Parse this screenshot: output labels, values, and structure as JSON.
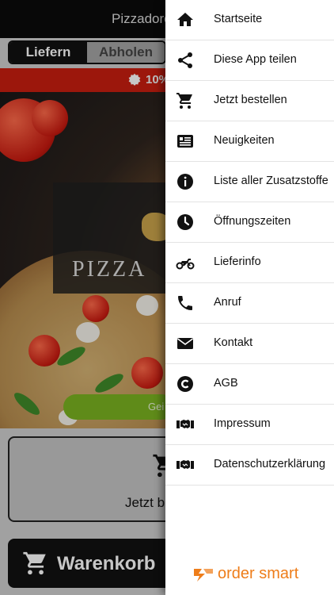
{
  "header": {
    "title": "Pizzadorc"
  },
  "segment": {
    "active_label": "Liefern",
    "inactive_label": "Abholen"
  },
  "promo": {
    "text": "10%",
    "color": "#c81e10"
  },
  "hero": {
    "logo_text": "PIZZA",
    "button_label": "Gei"
  },
  "order_card": {
    "label": "Jetzt b",
    "icon": "cart-add-icon"
  },
  "cart_button": {
    "label": "Warenkorb",
    "icon": "cart-icon"
  },
  "drawer": {
    "items": [
      {
        "label": "Startseite",
        "icon": "home-icon"
      },
      {
        "label": "Diese App teilen",
        "icon": "share-icon"
      },
      {
        "label": "Jetzt bestellen",
        "icon": "cart-icon"
      },
      {
        "label": "Neuigkeiten",
        "icon": "news-icon"
      },
      {
        "label": "Liste aller Zusatzstoffe",
        "icon": "info-icon"
      },
      {
        "label": "Öffnungszeiten",
        "icon": "clock-icon"
      },
      {
        "label": "Lieferinfo",
        "icon": "motorcycle-icon"
      },
      {
        "label": "Anruf",
        "icon": "phone-icon"
      },
      {
        "label": "Kontakt",
        "icon": "mail-icon"
      },
      {
        "label": "AGB",
        "icon": "copyright-icon"
      },
      {
        "label": "Impressum",
        "icon": "handshake-icon"
      },
      {
        "label": "Datenschutzerklärung",
        "icon": "handshake-icon"
      }
    ],
    "brand": {
      "name": "order smart",
      "color": "#ee7d1a"
    }
  },
  "colors": {
    "accent_green": "#7ab320",
    "dark": "#111111"
  }
}
